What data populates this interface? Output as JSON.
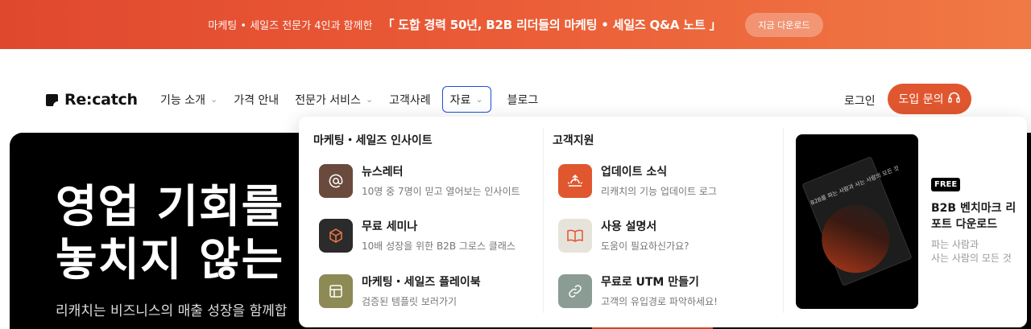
{
  "banner": {
    "pre": "마케팅 • 세일즈 전문가 4인과 함께한",
    "main": "「 도합 경력 50년, B2B 리더들의 마케팅 • 세일즈 Q&A 노트 」",
    "button": "지금 다운로드"
  },
  "nav": {
    "logo": "Re:catch",
    "items": [
      {
        "label": "기능 소개",
        "chev": "⌄"
      },
      {
        "label": "가격 안내"
      },
      {
        "label": "전문가 서비스",
        "chev": "⌄"
      },
      {
        "label": "고객사례"
      },
      {
        "label": "자료",
        "chev": "⌄"
      },
      {
        "label": "블로그"
      }
    ],
    "login": "로그인",
    "cta": "도입 문의"
  },
  "hero": {
    "line1": "영업 기회를",
    "line2": "놓치지 않는 C",
    "sub": "리캐치는 비즈니스의 매출 성장을 함께합"
  },
  "dropdown": {
    "col1": {
      "title": "마케팅・세일즈 인사이트",
      "items": [
        {
          "title": "뉴스레터",
          "sub": "10명 중 7명이 믿고 열어보는 인사이트",
          "icon": "at-icon",
          "color": "#6b4a3e"
        },
        {
          "title": "무료 세미나",
          "sub": "10배 성장을 위한 B2B 그로스 클래스",
          "icon": "box-icon",
          "color": "#2b2b2b"
        },
        {
          "title": "마케팅・세일즈 플레이북",
          "sub": "검증된 템플릿 보러가기",
          "icon": "layout-icon",
          "color": "#8d8a55"
        }
      ]
    },
    "col2": {
      "title": "고객지원",
      "items": [
        {
          "title": "업데이트 소식",
          "sub": "리캐치의 기능 업데이트 로그",
          "icon": "sunrise-icon",
          "color": "#e0572f"
        },
        {
          "title": "사용 설명서",
          "sub": "도움이 필요하신가요?",
          "icon": "book-icon",
          "color": "#e6e3da"
        },
        {
          "title": "무료로 UTM 만들기",
          "sub": "고객의 유입경로 파악하세요!",
          "icon": "link-icon",
          "color": "#8a9c93"
        }
      ]
    },
    "promo": {
      "badge": "FREE",
      "title": "B2B 벤치마크 리포트 다운로드",
      "sub1": "파는 사람과",
      "sub2": "사는 사람의 모든 것",
      "book_text": "B2B를 파는 사람과 사는 사람의 모든 것"
    }
  }
}
